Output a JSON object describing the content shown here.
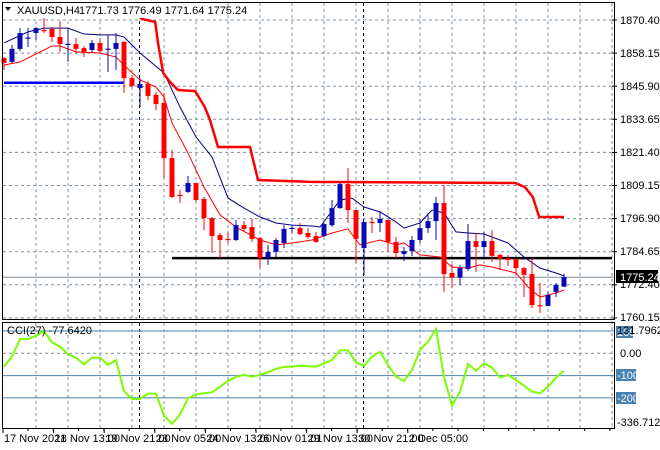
{
  "header": {
    "menu_icon": "triangle-down-icon",
    "symbol": "XAUUSD,H4",
    "ohlc": "1771.73 1776.49 1771.64 1775.24"
  },
  "price_axis": {
    "labels": [
      "1870.40",
      "1858.15",
      "1845.90",
      "1833.65",
      "1821.40",
      "1809.15",
      "1796.90",
      "1784.65",
      "1772.40",
      "1760.15"
    ],
    "current_price": "1775.24"
  },
  "cci": {
    "label": "CCI(27) -77.6420",
    "axis": {
      "max": "131.7962",
      "p100": "100",
      "zero": "0.00",
      "m100": "-100",
      "m200": "-200",
      "min": "-336.7125"
    }
  },
  "time_axis": {
    "labels": [
      "17 Nov 2021",
      "18 Nov 13:00",
      "19 Nov 21:00",
      "23 Nov 05:00",
      "24 Nov 13:00",
      "26 Nov 01:01",
      "29 Nov 13:00",
      "30 Nov 21:00",
      "2 Dec 05:00"
    ]
  },
  "colors": {
    "bull": "#0a0ab4",
    "bear": "#ff0000",
    "ma_fast": "#ff0000",
    "ma_slow": "#000080",
    "trail": "#ff0000",
    "cci": "#7cfc00",
    "cci_levels": "#4682b4",
    "grid": "#8090a0"
  },
  "chart_data": {
    "type": "candlestick",
    "symbol": "XAUUSD",
    "timeframe": "H4",
    "ylim": [
      1760.15,
      1870.4
    ],
    "candles_ohlc": [
      [
        1856.3,
        1856.7,
        1851.9,
        1854.5
      ],
      [
        1854.9,
        1861.2,
        1854.5,
        1859.7
      ],
      [
        1859.7,
        1867.4,
        1858.9,
        1865.6
      ],
      [
        1863.7,
        1867.4,
        1860.4,
        1863.9
      ],
      [
        1865.6,
        1867.8,
        1863.0,
        1867.4
      ],
      [
        1866.7,
        1871.1,
        1865.6,
        1866.5
      ],
      [
        1867.1,
        1867.8,
        1862.3,
        1864.1
      ],
      [
        1864.1,
        1870.0,
        1858.6,
        1861.5
      ],
      [
        1861.5,
        1867.4,
        1854.9,
        1861.6
      ],
      [
        1861.5,
        1863.7,
        1858.2,
        1859.7
      ],
      [
        1860.0,
        1860.8,
        1856.7,
        1858.6
      ],
      [
        1859.3,
        1863.0,
        1858.2,
        1861.9
      ],
      [
        1861.9,
        1863.7,
        1858.2,
        1858.9
      ],
      [
        1859.7,
        1864.9,
        1851.2,
        1859.8
      ],
      [
        1859.7,
        1865.6,
        1851.9,
        1861.9
      ],
      [
        1862.3,
        1862.6,
        1843.4,
        1848.9
      ],
      [
        1848.9,
        1850.0,
        1845.6,
        1846.0
      ],
      [
        1845.2,
        1848.9,
        1838.2,
        1846.7
      ],
      [
        1846.7,
        1847.8,
        1840.8,
        1842.3
      ],
      [
        1842.7,
        1843.8,
        1837.1,
        1839.3
      ],
      [
        1839.7,
        1843.4,
        1811.9,
        1819.3
      ],
      [
        1819.3,
        1822.3,
        1804.5,
        1804.9
      ],
      [
        1805.7,
        1807.5,
        1802.7,
        1805.5
      ],
      [
        1806.8,
        1812.7,
        1806.4,
        1810.1
      ],
      [
        1810.1,
        1810.1,
        1803.1,
        1803.8
      ],
      [
        1804.2,
        1804.9,
        1792.7,
        1797.1
      ],
      [
        1797.1,
        1797.5,
        1784.2,
        1790.5
      ],
      [
        1790.8,
        1791.6,
        1782.3,
        1789.0
      ],
      [
        1789.4,
        1792.0,
        1787.9,
        1789.2
      ],
      [
        1789.0,
        1796.4,
        1788.6,
        1794.5
      ],
      [
        1794.5,
        1796.0,
        1792.0,
        1793.1
      ],
      [
        1793.8,
        1796.8,
        1788.3,
        1789.4
      ],
      [
        1789.7,
        1790.1,
        1778.6,
        1782.3
      ],
      [
        1782.3,
        1787.2,
        1779.8,
        1784.6
      ],
      [
        1784.6,
        1789.7,
        1782.7,
        1789.0
      ],
      [
        1787.9,
        1794.5,
        1786.0,
        1793.1
      ],
      [
        1793.4,
        1794.5,
        1791.6,
        1793.5
      ],
      [
        1793.4,
        1795.3,
        1790.8,
        1791.2
      ],
      [
        1791.6,
        1793.4,
        1789.4,
        1790.1
      ],
      [
        1790.5,
        1792.0,
        1787.9,
        1788.3
      ],
      [
        1790.5,
        1795.3,
        1790.1,
        1794.9
      ],
      [
        1794.5,
        1803.8,
        1793.8,
        1800.8
      ],
      [
        1800.8,
        1810.5,
        1800.5,
        1809.7
      ],
      [
        1809.7,
        1815.6,
        1795.3,
        1800.1
      ],
      [
        1800.1,
        1800.1,
        1780.5,
        1789.4
      ],
      [
        1786.0,
        1795.7,
        1776.1,
        1795.7
      ],
      [
        1795.7,
        1797.5,
        1791.6,
        1795.5
      ],
      [
        1795.3,
        1799.7,
        1792.0,
        1796.8
      ],
      [
        1796.4,
        1796.4,
        1784.6,
        1788.3
      ],
      [
        1788.3,
        1790.1,
        1782.3,
        1784.2
      ],
      [
        1783.8,
        1786.4,
        1781.2,
        1784.9
      ],
      [
        1784.9,
        1790.5,
        1783.1,
        1789.0
      ],
      [
        1789.0,
        1796.8,
        1787.9,
        1793.4
      ],
      [
        1793.4,
        1799.0,
        1791.6,
        1796.0
      ],
      [
        1796.0,
        1804.9,
        1789.0,
        1802.7
      ],
      [
        1802.7,
        1809.4,
        1769.8,
        1776.4
      ],
      [
        1776.8,
        1780.1,
        1771.2,
        1775.1
      ],
      [
        1775.1,
        1779.8,
        1772.4,
        1778.6
      ],
      [
        1778.3,
        1794.9,
        1777.5,
        1788.6
      ],
      [
        1788.6,
        1791.6,
        1777.2,
        1786.4
      ],
      [
        1786.4,
        1792.0,
        1782.7,
        1788.6
      ],
      [
        1788.6,
        1792.7,
        1780.9,
        1783.1
      ],
      [
        1783.5,
        1783.8,
        1777.9,
        1782.0
      ],
      [
        1782.3,
        1783.5,
        1779.4,
        1781.6
      ],
      [
        1782.0,
        1782.0,
        1776.1,
        1778.6
      ],
      [
        1778.6,
        1779.0,
        1767.9,
        1776.1
      ],
      [
        1776.4,
        1782.3,
        1763.8,
        1764.9
      ],
      [
        1764.9,
        1773.1,
        1762.0,
        1764.7
      ],
      [
        1764.6,
        1769.8,
        1764.6,
        1768.7
      ],
      [
        1769.8,
        1773.1,
        1767.9,
        1772.4
      ],
      [
        1771.73,
        1776.49,
        1771.64,
        1775.24
      ]
    ],
    "ma_slow": [
      [
        1,
        1861.9
      ],
      [
        4,
        1866.0
      ],
      [
        6,
        1867.4
      ],
      [
        9,
        1867.4
      ],
      [
        11,
        1865.2
      ],
      [
        13,
        1864.9
      ],
      [
        15,
        1864.9
      ],
      [
        16,
        1864.1
      ],
      [
        18,
        1858.2
      ],
      [
        21,
        1850.8
      ],
      [
        23,
        1838.2
      ],
      [
        25,
        1827.1
      ],
      [
        27,
        1819.7
      ],
      [
        29,
        1804.5
      ],
      [
        31,
        1800.8
      ],
      [
        33,
        1797.5
      ],
      [
        35,
        1795.3
      ],
      [
        37,
        1794.5
      ],
      [
        39.5,
        1794.2
      ],
      [
        40.5,
        1793.8
      ],
      [
        43,
        1803.8
      ],
      [
        44.5,
        1804.5
      ],
      [
        46,
        1801.2
      ],
      [
        48,
        1799.4
      ],
      [
        50,
        1795.7
      ],
      [
        51,
        1793.4
      ],
      [
        53,
        1795.3
      ],
      [
        54.5,
        1800.1
      ],
      [
        56,
        1799.0
      ],
      [
        57.5,
        1792.0
      ],
      [
        59,
        1791.6
      ],
      [
        61,
        1791.2
      ],
      [
        64,
        1787.9
      ],
      [
        66,
        1782.7
      ],
      [
        68,
        1778.6
      ],
      [
        70,
        1776.8
      ],
      [
        71,
        1775.7
      ]
    ],
    "ma_fast": [
      [
        1,
        1853.7
      ],
      [
        3,
        1854.9
      ],
      [
        6,
        1859.3
      ],
      [
        7,
        1860.8
      ],
      [
        8,
        1860.8
      ],
      [
        10,
        1858.6
      ],
      [
        13,
        1858.2
      ],
      [
        15,
        1856.7
      ],
      [
        16,
        1853.7
      ],
      [
        18,
        1848.2
      ],
      [
        20,
        1845.6
      ],
      [
        21,
        1841.9
      ],
      [
        22,
        1832.3
      ],
      [
        24,
        1821.2
      ],
      [
        26,
        1808.6
      ],
      [
        28,
        1798.3
      ],
      [
        30,
        1793.8
      ],
      [
        33,
        1789.0
      ],
      [
        35,
        1787.2
      ],
      [
        37,
        1787.9
      ],
      [
        39.5,
        1789.0
      ],
      [
        42,
        1791.6
      ],
      [
        44,
        1793.1
      ],
      [
        45.5,
        1787.2
      ],
      [
        48,
        1789.0
      ],
      [
        50,
        1787.2
      ],
      [
        51,
        1787.9
      ],
      [
        53,
        1783.5
      ],
      [
        55.5,
        1782.7
      ],
      [
        57,
        1779.0
      ],
      [
        59,
        1778.6
      ],
      [
        60.5,
        1779.8
      ],
      [
        62,
        1779.0
      ],
      [
        65,
        1776.8
      ],
      [
        66.5,
        1771.6
      ],
      [
        68,
        1767.9
      ],
      [
        70,
        1769.4
      ],
      [
        71,
        1770.5
      ]
    ],
    "trailing_stop": [
      [
        16.75,
        1874.1
      ],
      [
        18.25,
        1870.8
      ],
      [
        19.9,
        1869.7
      ],
      [
        20.25,
        1861.9
      ],
      [
        20.9,
        1850.8
      ],
      [
        21.75,
        1847.5
      ],
      [
        22.75,
        1844.5
      ],
      [
        24.9,
        1844.1
      ],
      [
        26.1,
        1838.2
      ],
      [
        26.75,
        1833.4
      ],
      [
        27.75,
        1823.4
      ],
      [
        31.75,
        1823.4
      ],
      [
        32.75,
        1811.2
      ],
      [
        39.25,
        1810.5
      ],
      [
        64.9,
        1810.1
      ],
      [
        66.1,
        1808.6
      ],
      [
        67.1,
        1804.9
      ],
      [
        67.9,
        1797.5
      ],
      [
        71,
        1797.5
      ]
    ],
    "horizontal_lines": [
      {
        "name": "support-blue",
        "price": 1847.2,
        "from_bar": 1,
        "to_bar": 16,
        "color": "#0000ff"
      },
      {
        "name": "support-black",
        "price": 1782.3,
        "from_bar": 22,
        "to_bar": 77,
        "color": "#000000"
      }
    ],
    "current_price_line": 1775.24,
    "period_separators_bars": [
      18,
      46
    ],
    "cci_period": 27,
    "cci_levels": [
      100,
      0,
      -100,
      -200
    ],
    "cci_range": [
      -336.7125,
      131.7962
    ],
    "cci": [
      [
        1,
        -60
      ],
      [
        2,
        -15
      ],
      [
        3,
        64
      ],
      [
        4,
        64
      ],
      [
        5,
        79
      ],
      [
        6,
        100
      ],
      [
        7,
        49
      ],
      [
        8,
        30
      ],
      [
        9,
        -4
      ],
      [
        10,
        -20
      ],
      [
        11,
        -49
      ],
      [
        12,
        -20
      ],
      [
        13,
        -20
      ],
      [
        14,
        -52
      ],
      [
        15,
        -31
      ],
      [
        16,
        -169
      ],
      [
        17,
        -205
      ],
      [
        18,
        -205
      ],
      [
        19,
        -181
      ],
      [
        20,
        -181
      ],
      [
        21,
        -280
      ],
      [
        22,
        -316
      ],
      [
        23,
        -274
      ],
      [
        24,
        -202
      ],
      [
        25,
        -184
      ],
      [
        26,
        -179
      ],
      [
        27,
        -175
      ],
      [
        28,
        -150
      ],
      [
        29,
        -124
      ],
      [
        30,
        -106
      ],
      [
        31,
        -97
      ],
      [
        32,
        -105
      ],
      [
        33,
        -97
      ],
      [
        34,
        -85
      ],
      [
        35,
        -70
      ],
      [
        36,
        -61
      ],
      [
        37,
        -60
      ],
      [
        38,
        -56
      ],
      [
        40,
        -60
      ],
      [
        41,
        -45
      ],
      [
        42,
        -30
      ],
      [
        43,
        13
      ],
      [
        44,
        13
      ],
      [
        45,
        -42
      ],
      [
        46,
        -56
      ],
      [
        47,
        -15
      ],
      [
        48,
        7
      ],
      [
        49,
        -52
      ],
      [
        50,
        -105
      ],
      [
        51,
        -124
      ],
      [
        52,
        -75
      ],
      [
        53,
        15
      ],
      [
        54,
        52
      ],
      [
        55,
        109
      ],
      [
        56,
        -105
      ],
      [
        57,
        -235
      ],
      [
        58,
        -172
      ],
      [
        59,
        -47
      ],
      [
        60,
        -79
      ],
      [
        61,
        -45
      ],
      [
        62,
        -63
      ],
      [
        63,
        -109
      ],
      [
        64,
        -97
      ],
      [
        65,
        -120
      ],
      [
        66,
        -145
      ],
      [
        67,
        -172
      ],
      [
        68,
        -179
      ],
      [
        69,
        -150
      ],
      [
        70,
        -109
      ],
      [
        71,
        -77.64
      ]
    ]
  }
}
